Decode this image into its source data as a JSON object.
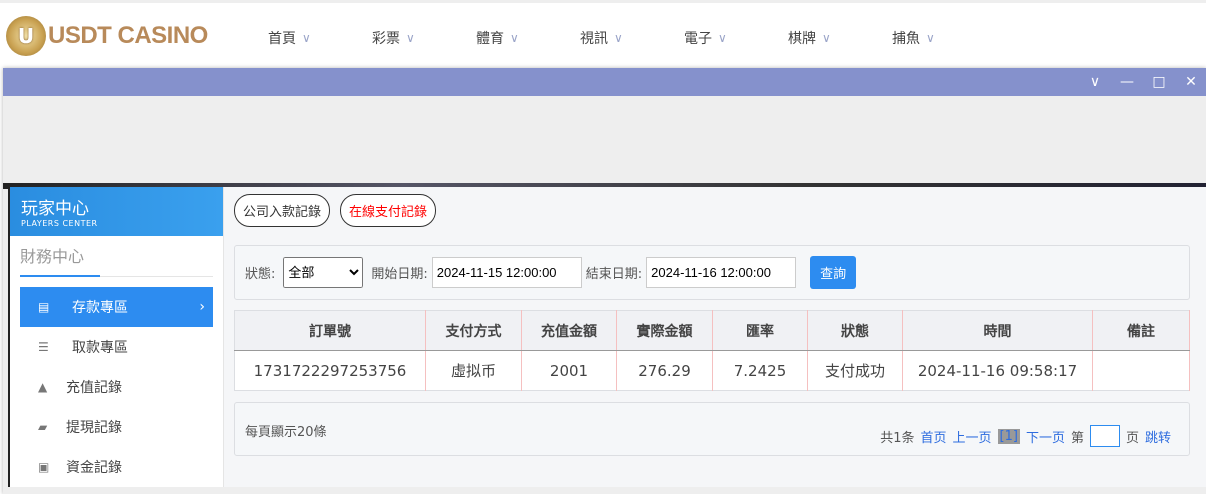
{
  "brand": {
    "logo_letter": "U",
    "name": "USDT CASINO"
  },
  "nav": [
    {
      "label": "首頁"
    },
    {
      "label": "彩票"
    },
    {
      "label": "體育"
    },
    {
      "label": "視訊"
    },
    {
      "label": "電子"
    },
    {
      "label": "棋牌"
    },
    {
      "label": "捕魚"
    }
  ],
  "window": {
    "controls": [
      "chevron-down",
      "minimize",
      "maximize",
      "close"
    ]
  },
  "sidebar": {
    "title": "玩家中心",
    "subtitle": "PLAYERS CENTER",
    "section": "財務中心",
    "items": [
      {
        "label": "存款專區",
        "active": true
      },
      {
        "label": "取款專區"
      },
      {
        "label": "充值記錄"
      },
      {
        "label": "提現記錄"
      },
      {
        "label": "資金記錄"
      }
    ]
  },
  "tabs": [
    {
      "label": "公司入款記錄"
    },
    {
      "label": "在線支付記錄",
      "color": "#ff0000"
    }
  ],
  "filter": {
    "status_label": "狀態:",
    "status_value": "全部",
    "start_label": "開始日期:",
    "start_value": "2024-11-15 12:00:00",
    "end_label": "結束日期:",
    "end_value": "2024-11-16 12:00:00",
    "query": "查詢"
  },
  "table": {
    "headers": [
      "訂單號",
      "支付方式",
      "充值金額",
      "實際金額",
      "匯率",
      "狀態",
      "時間",
      "備註"
    ],
    "rows": [
      [
        "1731722297253756",
        "虛拟币",
        "2001",
        "276.29",
        "7.2425",
        "支付成功",
        "2024-11-16 09:58:17",
        ""
      ]
    ]
  },
  "pager": {
    "per_page": "每頁顯示20條",
    "total": "共1条",
    "first": "首页",
    "prev": "上一页",
    "current": "[1]",
    "next": "下一页",
    "goto_prefix": "第",
    "goto_suffix": "页",
    "jump": "跳转"
  },
  "colors": {
    "accent": "#2d8cf0",
    "titlebar": "#8591cc"
  }
}
